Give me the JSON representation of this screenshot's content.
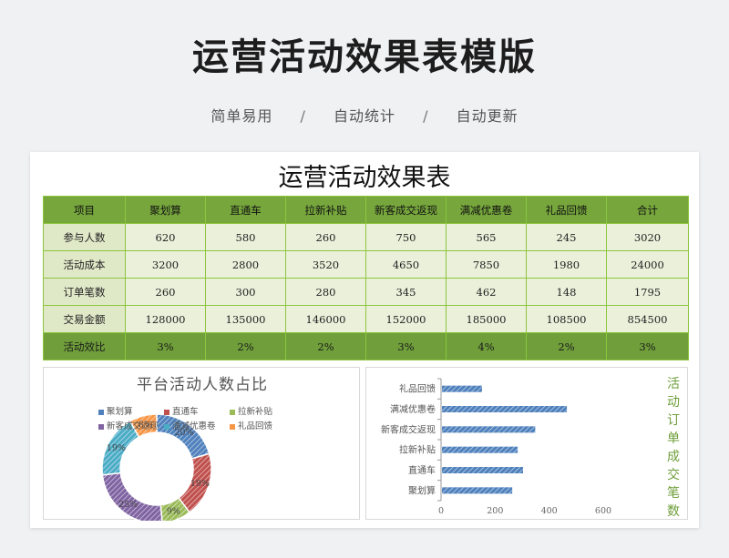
{
  "hero": {
    "title": "运营活动效果表模版",
    "tags": [
      "简单易用",
      "自动统计",
      "自动更新"
    ],
    "separator": "/"
  },
  "sheet": {
    "title": "运营活动效果表",
    "headers": [
      "项目",
      "聚划算",
      "直通车",
      "拉新补贴",
      "新客成交返现",
      "满减优惠卷",
      "礼品回馈",
      "合计"
    ],
    "rows": [
      [
        "参与人数",
        "620",
        "580",
        "260",
        "750",
        "565",
        "245",
        "3020"
      ],
      [
        "活动成本",
        "3200",
        "2800",
        "3520",
        "4650",
        "7850",
        "1980",
        "24000"
      ],
      [
        "订单笔数",
        "260",
        "300",
        "280",
        "345",
        "462",
        "148",
        "1795"
      ],
      [
        "交易金额",
        "128000",
        "135000",
        "146000",
        "152000",
        "185000",
        "108500",
        "854500"
      ]
    ],
    "footer": [
      "活动效比",
      "3%",
      "2%",
      "2%",
      "3%",
      "4%",
      "2%",
      "3%"
    ]
  },
  "chart_data": [
    {
      "type": "pie",
      "title": "平台活动人数占比",
      "categories": [
        "聚划算",
        "直通车",
        "拉新补贴",
        "新客成交返现",
        "满减优惠卷",
        "礼品回馈"
      ],
      "values": [
        620,
        580,
        260,
        750,
        565,
        245
      ],
      "labels": [
        "20%",
        "19%",
        "9%",
        "25%",
        "19%",
        "8%"
      ],
      "colors": [
        "#4f81bd",
        "#c0504d",
        "#9bbb59",
        "#8064a2",
        "#4bacc6",
        "#f79646"
      ],
      "legend": "top"
    },
    {
      "type": "bar",
      "orientation": "horizontal",
      "title": "活动订单成交笔数",
      "categories": [
        "聚划算",
        "直通车",
        "拉新补贴",
        "新客成交返现",
        "满减优惠卷",
        "礼品回馈"
      ],
      "values": [
        260,
        300,
        280,
        345,
        462,
        148
      ],
      "xlim": [
        0,
        600
      ],
      "xticks": [
        "0",
        "200",
        "400",
        "600"
      ],
      "color": "#4f81bd"
    }
  ]
}
